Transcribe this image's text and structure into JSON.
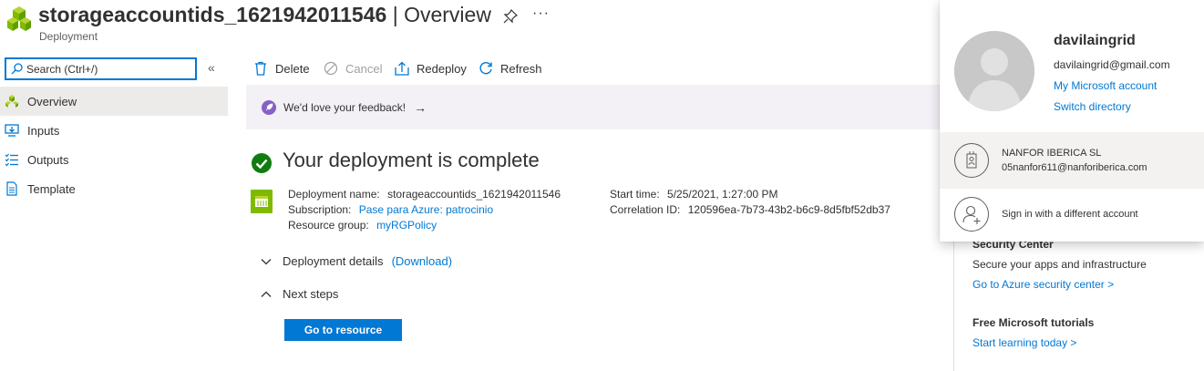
{
  "header": {
    "title_main": "storageaccountids_1621942011546",
    "title_sep": " | ",
    "title_section": "Overview",
    "subtitle": "Deployment",
    "more_label": "···"
  },
  "sidebar": {
    "search_placeholder": "Search (Ctrl+/)",
    "collapse_label": "«",
    "items": [
      {
        "label": "Overview",
        "icon": "deployment-overview-icon"
      },
      {
        "label": "Inputs",
        "icon": "inputs-icon"
      },
      {
        "label": "Outputs",
        "icon": "outputs-icon"
      },
      {
        "label": "Template",
        "icon": "template-icon"
      }
    ]
  },
  "toolbar": {
    "delete_label": "Delete",
    "cancel_label": "Cancel",
    "redeploy_label": "Redeploy",
    "refresh_label": "Refresh"
  },
  "feedback": {
    "text": "We'd love your feedback!",
    "arrow": "→"
  },
  "main": {
    "headline": "Your deployment is complete",
    "deployment_name_label": "Deployment name:",
    "deployment_name": "storageaccountids_1621942011546",
    "subscription_label": "Subscription:",
    "subscription": "Pase para Azure: patrocinio",
    "resource_group_label": "Resource group:",
    "resource_group": "myRGPolicy",
    "start_time_label": "Start time:",
    "start_time": "5/25/2021, 1:27:00 PM",
    "correlation_label": "Correlation ID:",
    "correlation_id": "120596ea-7b73-43b2-b6c9-8d5fbf52db37",
    "details_label": "Deployment details",
    "download_label": "(Download)",
    "next_steps_label": "Next steps",
    "go_button": "Go to resource"
  },
  "right_panel": {
    "security_title": "Security Center",
    "security_text": "Secure your apps and infrastructure",
    "security_link": "Go to Azure security center >",
    "tutorials_title": "Free Microsoft tutorials",
    "tutorials_link": "Start learning today >"
  },
  "account_popup": {
    "name": "davilaingrid",
    "email": "davilaingrid@gmail.com",
    "my_account": "My Microsoft account",
    "switch_directory": "Switch directory",
    "org_name": "NANFOR IBERICA SL",
    "org_email": "05nanfor611@nanforiberica.com",
    "different_account": "Sign in with a different account"
  },
  "colors": {
    "accent": "#0078d4",
    "success": "#107c10",
    "feedback_bg": "#f3f0f6",
    "nav_active": "#edebe9"
  }
}
